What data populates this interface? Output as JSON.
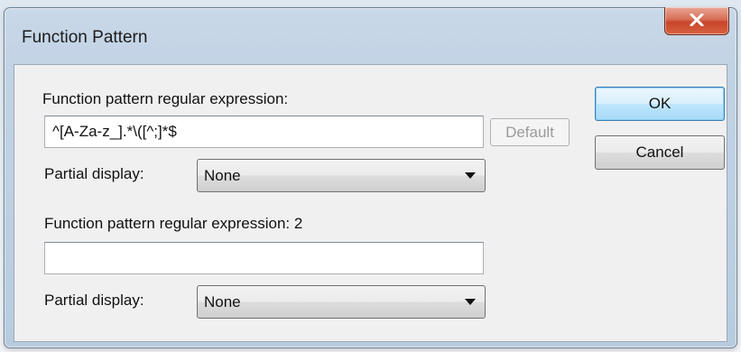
{
  "dialog": {
    "title": "Function Pattern",
    "close_icon": "close-icon"
  },
  "pattern1": {
    "label": "Function pattern regular expression:",
    "value": "^[A-Za-z_].*\\([^;]*$",
    "default_button": "Default",
    "partial_label": "Partial display:",
    "partial_value": "None"
  },
  "pattern2": {
    "label": "Function pattern regular expression: 2",
    "value": "",
    "partial_label": "Partial display:",
    "partial_value": "None"
  },
  "buttons": {
    "ok": "OK",
    "cancel": "Cancel"
  }
}
